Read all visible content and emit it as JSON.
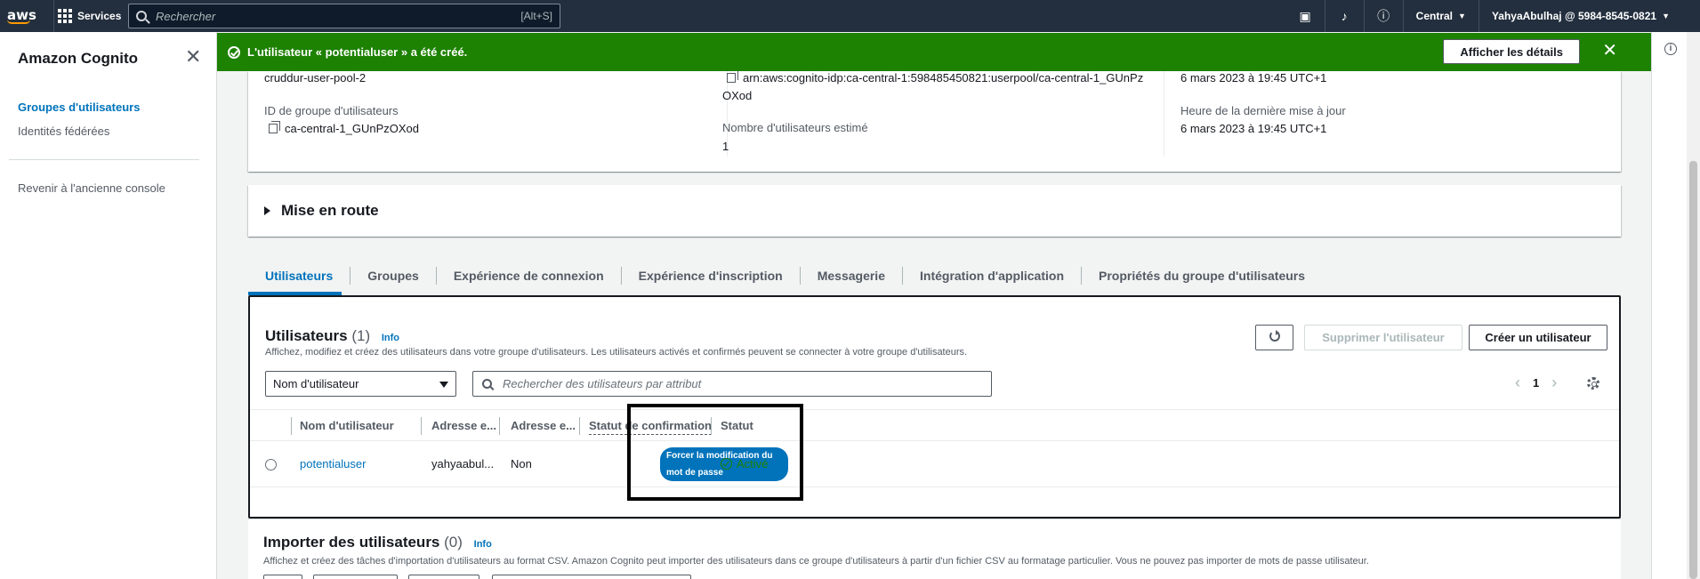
{
  "topnav": {
    "logo": "aws",
    "services_label": "Services",
    "search_placeholder": "Rechercher",
    "search_shortcut": "[Alt+S]",
    "region": "Central",
    "account": "YahyaAbulhaj @ 5984-8545-0821",
    "icons": [
      "cloudshell-icon",
      "bell-icon",
      "help-icon"
    ]
  },
  "sidebar": {
    "title": "Amazon Cognito",
    "items": [
      {
        "label": "Groupes d'utilisateurs",
        "active": true
      },
      {
        "label": "Identités fédérées",
        "active": false
      }
    ],
    "legacy_link": "Revenir à l'ancienne console"
  },
  "flash": {
    "message": "L'utilisateur « potentialuser » a été créé.",
    "details_button": "Afficher les détails",
    "color": "#1d8102"
  },
  "summary": {
    "pool_name": "cruddur-user-pool-2",
    "pool_id_label": "ID de groupe d'utilisateurs",
    "pool_id": "ca-central-1_GUnPzOXod",
    "arn_line1": "arn:aws:cognito-idp:ca-central-1:598485450821:userpool/ca-central-1_GUnPz",
    "arn_line2": "OXod",
    "users_label": "Nombre d'utilisateurs estimé",
    "users_value": "1",
    "created": "6 mars 2023 à 19:45 UTC+1",
    "updated_label": "Heure de la dernière mise à jour",
    "updated": "6 mars 2023 à 19:45 UTC+1"
  },
  "getting_started": {
    "title": "Mise en route"
  },
  "tabs": [
    {
      "label": "Utilisateurs",
      "active": true
    },
    {
      "label": "Groupes"
    },
    {
      "label": "Expérience de connexion"
    },
    {
      "label": "Expérience d'inscription"
    },
    {
      "label": "Messagerie"
    },
    {
      "label": "Intégration d'application"
    },
    {
      "label": "Propriétés du groupe d'utilisateurs"
    }
  ],
  "users": {
    "title": "Utilisateurs",
    "count": "(1)",
    "info": "Info",
    "description": "Affichez, modifiez et créez des utilisateurs dans votre groupe d'utilisateurs. Les utilisateurs activés et confirmés peuvent se connecter à votre groupe d'utilisateurs.",
    "delete_button": "Supprimer l'utilisateur",
    "create_button": "Créer un utilisateur",
    "filter_select": "Nom d'utilisateur",
    "filter_placeholder": "Rechercher des utilisateurs par attribut",
    "page": "1",
    "columns": [
      "Nom d'utilisateur",
      "Adresse e...",
      "Adresse e...",
      "Statut de confirmation",
      "Statut"
    ],
    "rows": [
      {
        "username": "potentialuser",
        "email": "yahyaabul...",
        "email_verified": "Non",
        "confirmation_line1": "Forcer la modification du",
        "confirmation_line2": "mot de passe",
        "status": "Activé"
      }
    ]
  },
  "import": {
    "title": "Importer des utilisateurs",
    "count": "(0)",
    "info": "Info",
    "description": "Affichez et créez des tâches d'importation d'utilisateurs au format CSV. Amazon Cognito peut importer des utilisateurs dans ce groupe d'utilisateurs à partir d'un fichier CSV au formatage particulier. Vous ne pouvez pas importer de mots de passe utilisateur."
  }
}
